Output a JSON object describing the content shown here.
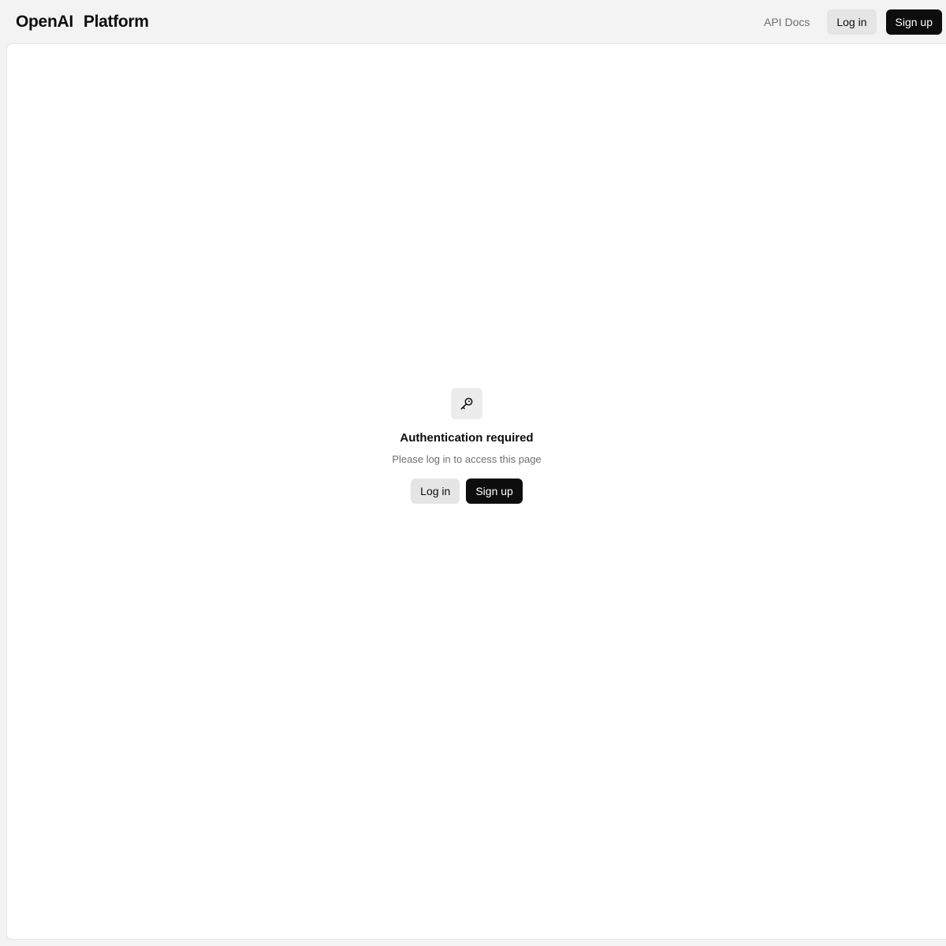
{
  "header": {
    "brand_primary": "OpenAI",
    "brand_secondary": "Platform",
    "nav": {
      "docs_label": "API Docs",
      "login_label": "Log in",
      "signup_label": "Sign up"
    }
  },
  "main": {
    "auth": {
      "icon": "key-icon",
      "title": "Authentication required",
      "subtitle": "Please log in to access this page",
      "login_label": "Log in",
      "signup_label": "Sign up"
    }
  },
  "colors": {
    "page_background": "#f3f3f3",
    "panel_background": "#ffffff",
    "button_dark": "#0d0d0d",
    "button_light": "#e5e5e5",
    "muted_text": "#6e6e6e"
  }
}
